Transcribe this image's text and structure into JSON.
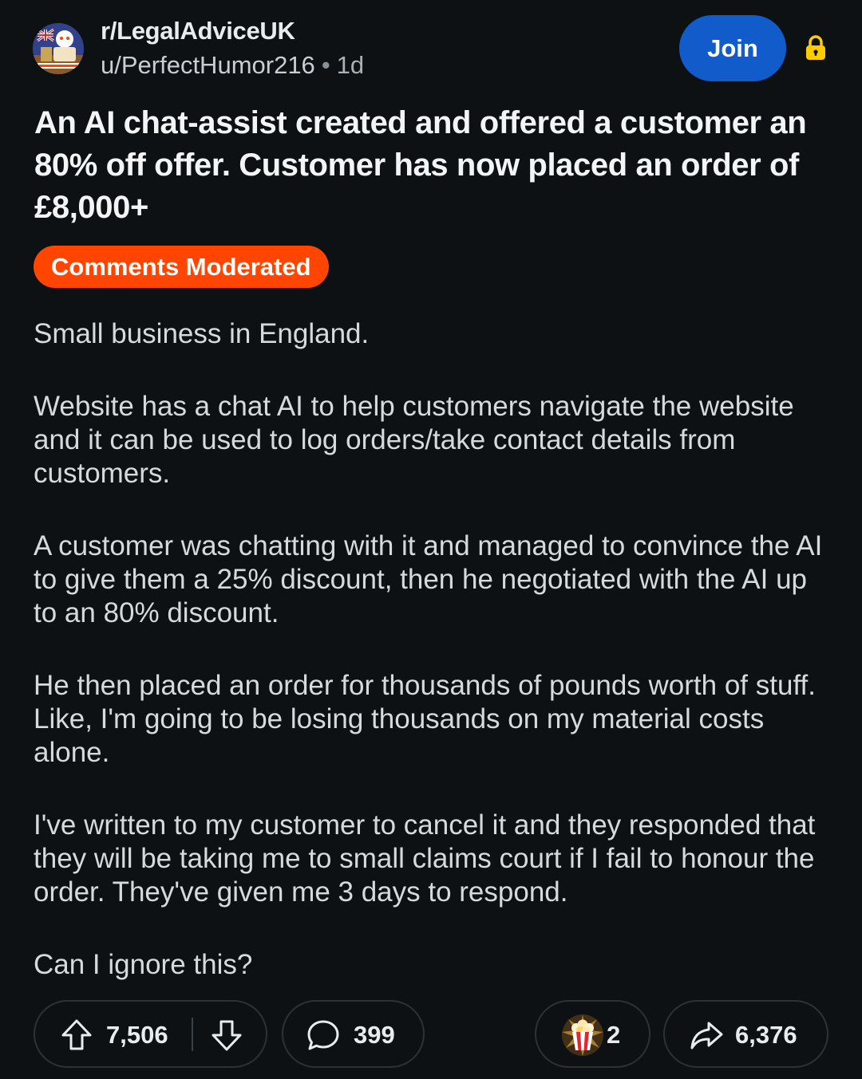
{
  "header": {
    "subreddit": "r/LegalAdviceUK",
    "username": "u/PerfectHumor216",
    "separator": "•",
    "age": "1d",
    "join_label": "Join",
    "avatar_icon": "subreddit-avatar-icon",
    "lock_icon": "lock-icon"
  },
  "post": {
    "title": "An AI chat-assist created and offered a customer an 80% off offer. Customer has now placed an order of £8,000+",
    "flair": "Comments Moderated",
    "paragraphs": [
      "Small business in England.",
      "Website has a chat AI to help customers navigate the website and it can be used to log orders/take contact details from customers.",
      "A customer was chatting with it and managed to convince the AI to give them a 25% discount, then he negotiated with the AI up to an 80% discount.",
      "He then placed an order for thousands of pounds worth of stuff. Like, I'm going to be losing thousands on my material costs alone.",
      "I've written to my customer to cancel it and they responded that they will be taking me to small claims court if I fail to honour the order. They've given me 3 days to respond.",
      "Can I ignore this?"
    ]
  },
  "actions": {
    "upvotes": "7,506",
    "comments": "399",
    "awards": "2",
    "shares": "6,376"
  },
  "colors": {
    "background": "#0e1113",
    "join_button": "#115bca",
    "flair": "#ff4500",
    "lock": "#ffcc00",
    "pill_border": "#2b3236"
  }
}
